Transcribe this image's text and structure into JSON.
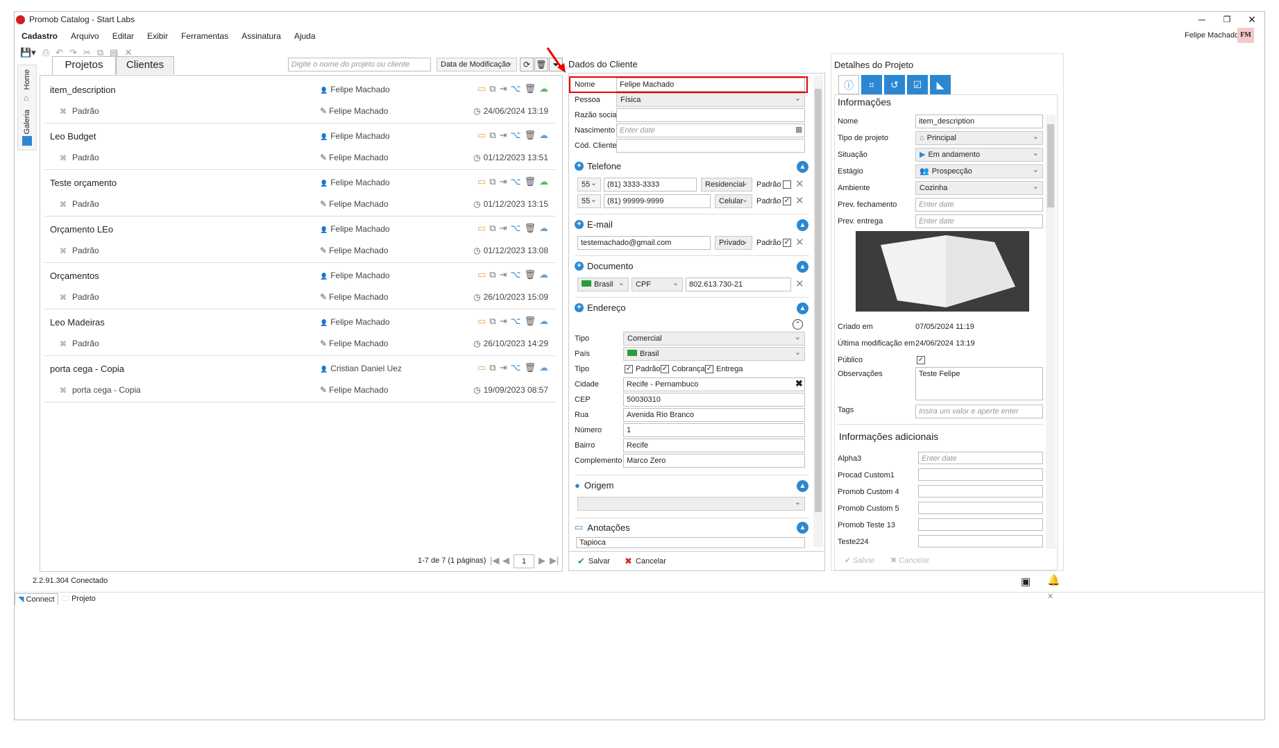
{
  "window": {
    "title": "Promob Catalog - Start Labs",
    "user": "Felipe Machado",
    "initials": "FM"
  },
  "menu": [
    "Cadastro",
    "Arquivo",
    "Editar",
    "Exibir",
    "Ferramentas",
    "Assinatura",
    "Ajuda"
  ],
  "side_tabs": [
    "Home",
    "Galeria"
  ],
  "projects_panel": {
    "tabs": [
      "Projetos",
      "Clientes"
    ],
    "search_placeholder": "Digite o nome do projeto ou cliente",
    "sort": "Data de Modificação",
    "items": [
      {
        "name": "item_description",
        "version": "Padrão",
        "owner": "Felipe Machado",
        "editor": "Felipe Machado",
        "date": "24/06/2024 13:19",
        "cloud": "green"
      },
      {
        "name": "Leo Budget",
        "version": "Padrão",
        "owner": "Felipe Machado",
        "editor": "Felipe Machado",
        "date": "01/12/2023 13:51",
        "cloud": "blue"
      },
      {
        "name": "Teste orçamento",
        "version": "Padrão",
        "owner": "Felipe Machado",
        "editor": "Felipe Machado",
        "date": "01/12/2023 13:15",
        "cloud": "green"
      },
      {
        "name": "Orçamento LEo",
        "version": "Padrão",
        "owner": "Felipe Machado",
        "editor": "Felipe Machado",
        "date": "01/12/2023 13:08",
        "cloud": "blue"
      },
      {
        "name": "Orçamentos",
        "version": "Padrão",
        "owner": "Felipe Machado",
        "editor": "Felipe Machado",
        "date": "26/10/2023 15:09",
        "cloud": "blue"
      },
      {
        "name": "Leo Madeiras",
        "version": "Padrão",
        "owner": "Felipe Machado",
        "editor": "Felipe Machado",
        "date": "26/10/2023 14:29",
        "cloud": "blue"
      },
      {
        "name": "porta cega - Copia",
        "version": "porta cega - Copia",
        "owner": "Cristian Daniel Uez",
        "editor": "Felipe Machado",
        "date": "19/09/2023 08:57",
        "cloud": "blue"
      }
    ],
    "pagination": {
      "summary": "1-7 de 7 (1 páginas)",
      "page": "1"
    }
  },
  "client": {
    "header": "Dados do Cliente",
    "labels": {
      "nome": "Nome",
      "pessoa": "Pessoa",
      "razao": "Razão social",
      "nascimento": "Nascimento",
      "cod": "Cód. Cliente"
    },
    "nome": "Felipe Machado",
    "pessoa": "Física",
    "nascimento_placeholder": "Enter date",
    "telefone": {
      "title": "Telefone",
      "rows": [
        {
          "ddi": "55",
          "number": "(81) 3333-3333",
          "type": "Residencial",
          "padrao": "Padrão",
          "checked": false
        },
        {
          "ddi": "55",
          "number": "(81) 99999-9999",
          "type": "Celular",
          "padrao": "Padrão",
          "checked": true
        }
      ]
    },
    "email": {
      "title": "E-mail",
      "value": "testemachado@gmail.com",
      "type": "Privado",
      "padrao": "Padrão"
    },
    "documento": {
      "title": "Documento",
      "country": "Brasil",
      "type": "CPF",
      "number": "802.613.730-21"
    },
    "endereco": {
      "title": "Endereço",
      "labels": {
        "tipo": "Tipo",
        "pais": "País",
        "tipo2": "Tipo",
        "cidade": "Cidade",
        "cep": "CEP",
        "rua": "Rua",
        "numero": "Número",
        "bairro": "Bairro",
        "complemento": "Complemento"
      },
      "tipo": "Comercial",
      "pais": "Brasil",
      "chk_padrao": "Padrão",
      "chk_cobranca": "Cobrança",
      "chk_entrega": "Entrega",
      "cidade": "Recife - Pernambuco",
      "cep": "50030310",
      "rua": "Avenida Rio Branco",
      "numero": "1",
      "bairro": "Recife",
      "complemento": "Marco Zero"
    },
    "origem": {
      "title": "Origem"
    },
    "anotacoes": {
      "title": "Anotações",
      "value": "Tapioca"
    },
    "save": "Salvar",
    "cancel": "Cancelar"
  },
  "details": {
    "header": "Detalhes do Projeto",
    "section": "Informações",
    "labels": {
      "nome": "Nome",
      "tipo": "Tipo de projeto",
      "situacao": "Situação",
      "estagio": "Estágio",
      "ambiente": "Ambiente",
      "prev_fech": "Prev. fechamento",
      "prev_ent": "Prev. entrega",
      "criado": "Criado em",
      "ultima": "Última modificação em",
      "publico": "Público",
      "obs": "Observações",
      "tags": "Tags"
    },
    "nome": "item_description",
    "tipo": "Principal",
    "situacao": "Em andamento",
    "estagio": "Prospecção",
    "ambiente": "Cozinha",
    "date_placeholder": "Enter date",
    "criado": "07/05/2024 11:19",
    "ultima": "24/06/2024 13:19",
    "obs": "Teste Felipe",
    "tags_placeholder": "Insira um valor e aperte enter",
    "additional": {
      "title": "Informações adicionais",
      "fields": [
        "Alpha3",
        "Procad Custom1",
        "Promob Custom 4",
        "Promob Custom 5",
        "Promob Teste 13",
        "Teste224"
      ]
    },
    "save": "Salvar",
    "cancel": "Cancelar"
  },
  "status": {
    "version": "2.2.91.304",
    "connection": "Conectado",
    "tabs": [
      "Connect",
      "Projeto"
    ]
  }
}
